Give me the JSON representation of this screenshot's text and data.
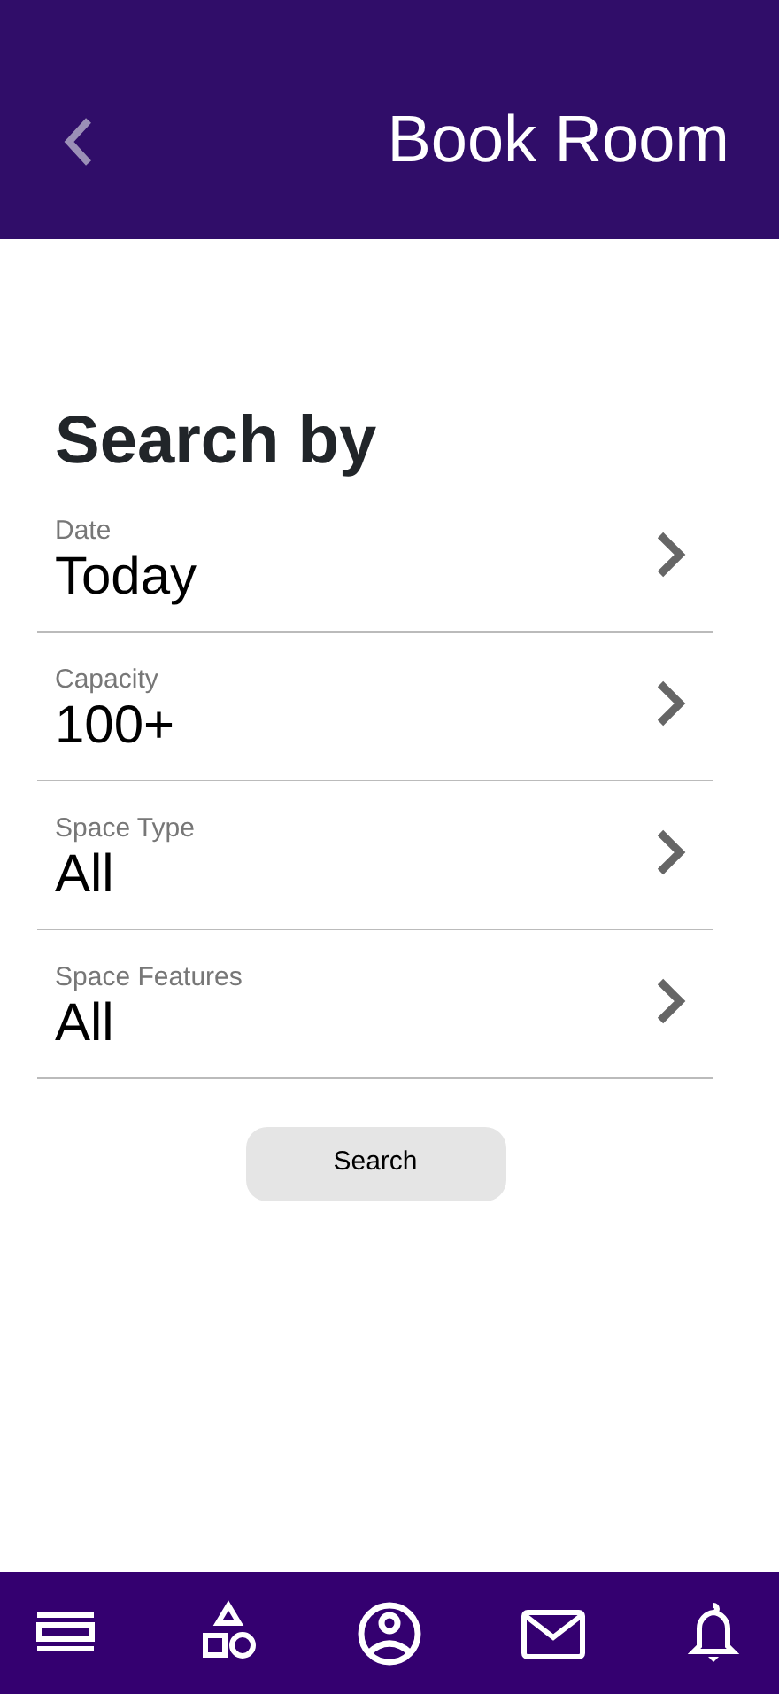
{
  "header": {
    "title": "Book Room"
  },
  "heading": "Search by",
  "filters": [
    {
      "label": "Date",
      "value": "Today"
    },
    {
      "label": "Capacity",
      "value": "100+"
    },
    {
      "label": "Space Type",
      "value": "All"
    },
    {
      "label": "Space Features",
      "value": "All"
    }
  ],
  "search_button": "Search",
  "bottom_nav": [
    {
      "kind": "menu"
    },
    {
      "kind": "shapes"
    },
    {
      "kind": "profile"
    },
    {
      "kind": "mail"
    },
    {
      "kind": "bell"
    }
  ]
}
